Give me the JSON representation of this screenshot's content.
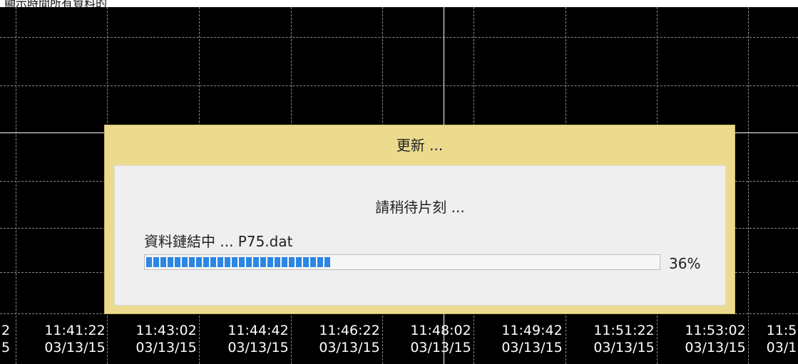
{
  "top_text": "顯示時間所有資料的",
  "dialog": {
    "title": "更新 ...",
    "wait_message": "請稍待片刻 ...",
    "status_message": "資料鏈結中 ... P75.dat",
    "progress": {
      "percent_label": "36%",
      "value": 0.36
    }
  },
  "time_axis": {
    "partial_left": {
      "time": "2",
      "date": "5"
    },
    "ticks": [
      {
        "time": "11:41:22",
        "date": "03/13/15"
      },
      {
        "time": "11:43:02",
        "date": "03/13/15"
      },
      {
        "time": "11:44:42",
        "date": "03/13/15"
      },
      {
        "time": "11:46:22",
        "date": "03/13/15"
      },
      {
        "time": "11:48:02",
        "date": "03/13/15"
      },
      {
        "time": "11:49:42",
        "date": "03/13/15"
      },
      {
        "time": "11:51:22",
        "date": "03/13/15"
      },
      {
        "time": "11:53:02",
        "date": "03/13/15"
      }
    ],
    "partial_right": {
      "time": "11:5",
      "date": "03/1"
    }
  },
  "colors": {
    "chart_background": "#000000",
    "grid": "#8a8a8a",
    "crosshair": "#ffffff",
    "dialog_frame": "#ecdb8f",
    "progress_fill": "#2b86e6"
  }
}
